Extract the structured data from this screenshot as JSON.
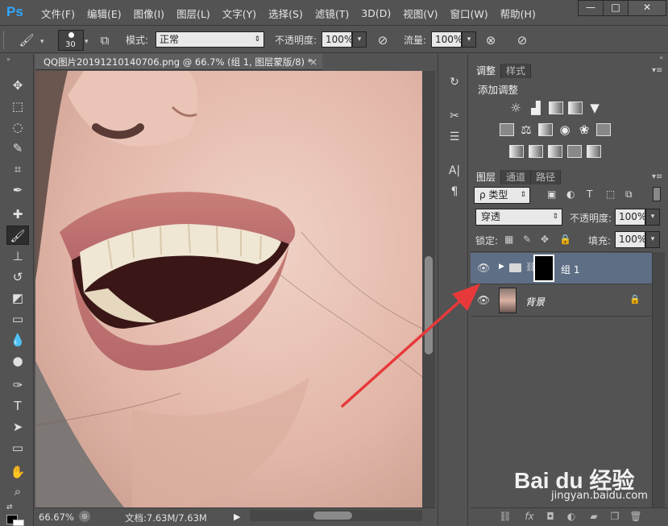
{
  "app": {
    "logo": "Ps"
  },
  "menubar": {
    "items": [
      "文件(F)",
      "编辑(E)",
      "图像(I)",
      "图层(L)",
      "文字(Y)",
      "选择(S)",
      "滤镜(T)",
      "3D(D)",
      "视图(V)",
      "窗口(W)",
      "帮助(H)"
    ],
    "window_buttons": [
      "—",
      "□",
      "✕"
    ]
  },
  "options": {
    "brush_size": "30",
    "mode_label": "模式:",
    "mode_value": "正常",
    "opacity_label": "不透明度:",
    "opacity_value": "100%",
    "flow_label": "流量:",
    "flow_value": "100%"
  },
  "document": {
    "tab_title": "QQ图片20191210140706.png @ 66.7% (组 1, 图层蒙版/8) *",
    "close": "×",
    "zoom": "66.67%",
    "doc_size": "文档:7.63M/7.63M"
  },
  "adjustments": {
    "tabs": [
      "调整",
      "样式"
    ],
    "heading": "添加调整"
  },
  "layers_panel": {
    "tabs": [
      "图层",
      "通道",
      "路径"
    ],
    "filter_label": "ρ 类型",
    "blend_mode": "穿透",
    "opacity_label": "不透明度:",
    "opacity_value": "100%",
    "lock_label": "锁定:",
    "fill_label": "填充:",
    "fill_value": "100%",
    "layers": [
      {
        "name": "组 1",
        "selected": true
      },
      {
        "name": "背景",
        "locked": true
      }
    ]
  },
  "watermark": {
    "brand": "Bai du 经验",
    "url": "jingyan.baidu.com"
  },
  "colors": {
    "ui_bg": "#535353",
    "selected_layer": "#5e6e85",
    "arrow": "#e8393a"
  }
}
